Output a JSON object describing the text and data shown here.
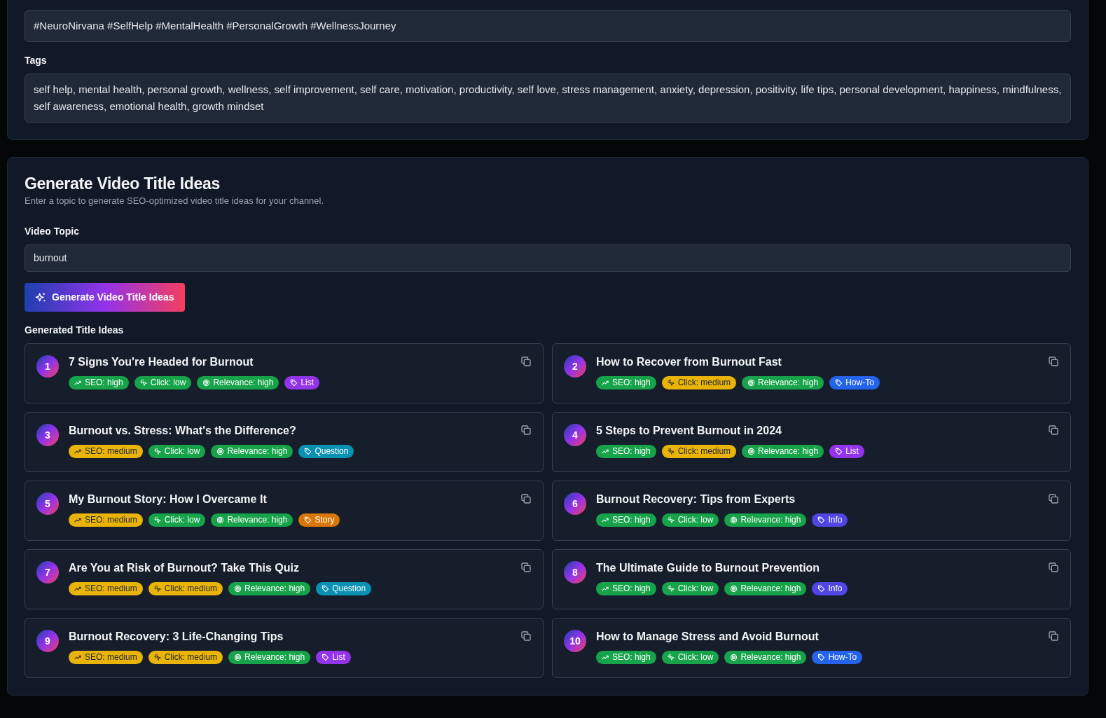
{
  "metadata_panel": {
    "fields": [
      {
        "value": "#NeuroNirvana #SelfHelp #MentalHealth #PersonalGrowth #WellnessJourney"
      },
      {
        "label": "Tags",
        "value": "self help, mental health, personal growth, wellness, self improvement, self care, motivation, productivity, self love, stress management, anxiety, depression, positivity, life tips, personal development, happiness, mindfulness, self awareness, emotional health, growth mindset"
      }
    ]
  },
  "title_generator": {
    "heading": "Generate Video Title Ideas",
    "subtitle": "Enter a topic to generate SEO-optimized video title ideas for your channel.",
    "topic_label": "Video Topic",
    "topic_value": "burnout",
    "generate_button": "Generate Video Title Ideas",
    "results_label": "Generated Title Ideas",
    "ideas": [
      {
        "number": "1",
        "title": "7 Signs You're Headed for Burnout",
        "badges": [
          {
            "kind": "seo",
            "text": "SEO: high",
            "color": "#16a34a"
          },
          {
            "kind": "click",
            "text": "Click: low",
            "color": "#16a34a"
          },
          {
            "kind": "relevance",
            "text": "Relevance: high",
            "color": "#16a34a"
          },
          {
            "kind": "type",
            "text": "List",
            "color": "#9333ea"
          }
        ]
      },
      {
        "number": "2",
        "title": "How to Recover from Burnout Fast",
        "badges": [
          {
            "kind": "seo",
            "text": "SEO: high",
            "color": "#16a34a"
          },
          {
            "kind": "click",
            "text": "Click: medium",
            "color": "#eab308"
          },
          {
            "kind": "relevance",
            "text": "Relevance: high",
            "color": "#16a34a"
          },
          {
            "kind": "type",
            "text": "How-To",
            "color": "#2563eb"
          }
        ]
      },
      {
        "number": "3",
        "title": "Burnout vs. Stress: What's the Difference?",
        "badges": [
          {
            "kind": "seo",
            "text": "SEO: medium",
            "color": "#eab308"
          },
          {
            "kind": "click",
            "text": "Click: low",
            "color": "#16a34a"
          },
          {
            "kind": "relevance",
            "text": "Relevance: high",
            "color": "#16a34a"
          },
          {
            "kind": "type",
            "text": "Question",
            "color": "#0891b2"
          }
        ]
      },
      {
        "number": "4",
        "title": "5 Steps to Prevent Burnout in 2024",
        "badges": [
          {
            "kind": "seo",
            "text": "SEO: high",
            "color": "#16a34a"
          },
          {
            "kind": "click",
            "text": "Click: medium",
            "color": "#eab308"
          },
          {
            "kind": "relevance",
            "text": "Relevance: high",
            "color": "#16a34a"
          },
          {
            "kind": "type",
            "text": "List",
            "color": "#9333ea"
          }
        ]
      },
      {
        "number": "5",
        "title": "My Burnout Story: How I Overcame It",
        "badges": [
          {
            "kind": "seo",
            "text": "SEO: medium",
            "color": "#eab308"
          },
          {
            "kind": "click",
            "text": "Click: low",
            "color": "#16a34a"
          },
          {
            "kind": "relevance",
            "text": "Relevance: high",
            "color": "#16a34a"
          },
          {
            "kind": "type",
            "text": "Story",
            "color": "#d97706"
          }
        ]
      },
      {
        "number": "6",
        "title": "Burnout Recovery: Tips from Experts",
        "badges": [
          {
            "kind": "seo",
            "text": "SEO: high",
            "color": "#16a34a"
          },
          {
            "kind": "click",
            "text": "Click: low",
            "color": "#16a34a"
          },
          {
            "kind": "relevance",
            "text": "Relevance: high",
            "color": "#16a34a"
          },
          {
            "kind": "type",
            "text": "Info",
            "color": "#4f46e5"
          }
        ]
      },
      {
        "number": "7",
        "title": "Are You at Risk of Burnout? Take This Quiz",
        "badges": [
          {
            "kind": "seo",
            "text": "SEO: medium",
            "color": "#eab308"
          },
          {
            "kind": "click",
            "text": "Click: medium",
            "color": "#eab308"
          },
          {
            "kind": "relevance",
            "text": "Relevance: high",
            "color": "#16a34a"
          },
          {
            "kind": "type",
            "text": "Question",
            "color": "#0891b2"
          }
        ]
      },
      {
        "number": "8",
        "title": "The Ultimate Guide to Burnout Prevention",
        "badges": [
          {
            "kind": "seo",
            "text": "SEO: high",
            "color": "#16a34a"
          },
          {
            "kind": "click",
            "text": "Click: low",
            "color": "#16a34a"
          },
          {
            "kind": "relevance",
            "text": "Relevance: high",
            "color": "#16a34a"
          },
          {
            "kind": "type",
            "text": "Info",
            "color": "#4f46e5"
          }
        ]
      },
      {
        "number": "9",
        "title": "Burnout Recovery: 3 Life-Changing Tips",
        "badges": [
          {
            "kind": "seo",
            "text": "SEO: medium",
            "color": "#eab308"
          },
          {
            "kind": "click",
            "text": "Click: medium",
            "color": "#eab308"
          },
          {
            "kind": "relevance",
            "text": "Relevance: high",
            "color": "#16a34a"
          },
          {
            "kind": "type",
            "text": "List",
            "color": "#9333ea"
          }
        ]
      },
      {
        "number": "10",
        "title": "How to Manage Stress and Avoid Burnout",
        "badges": [
          {
            "kind": "seo",
            "text": "SEO: high",
            "color": "#16a34a"
          },
          {
            "kind": "click",
            "text": "Click: low",
            "color": "#16a34a"
          },
          {
            "kind": "relevance",
            "text": "Relevance: high",
            "color": "#16a34a"
          },
          {
            "kind": "type",
            "text": "How-To",
            "color": "#2563eb"
          }
        ]
      }
    ]
  }
}
